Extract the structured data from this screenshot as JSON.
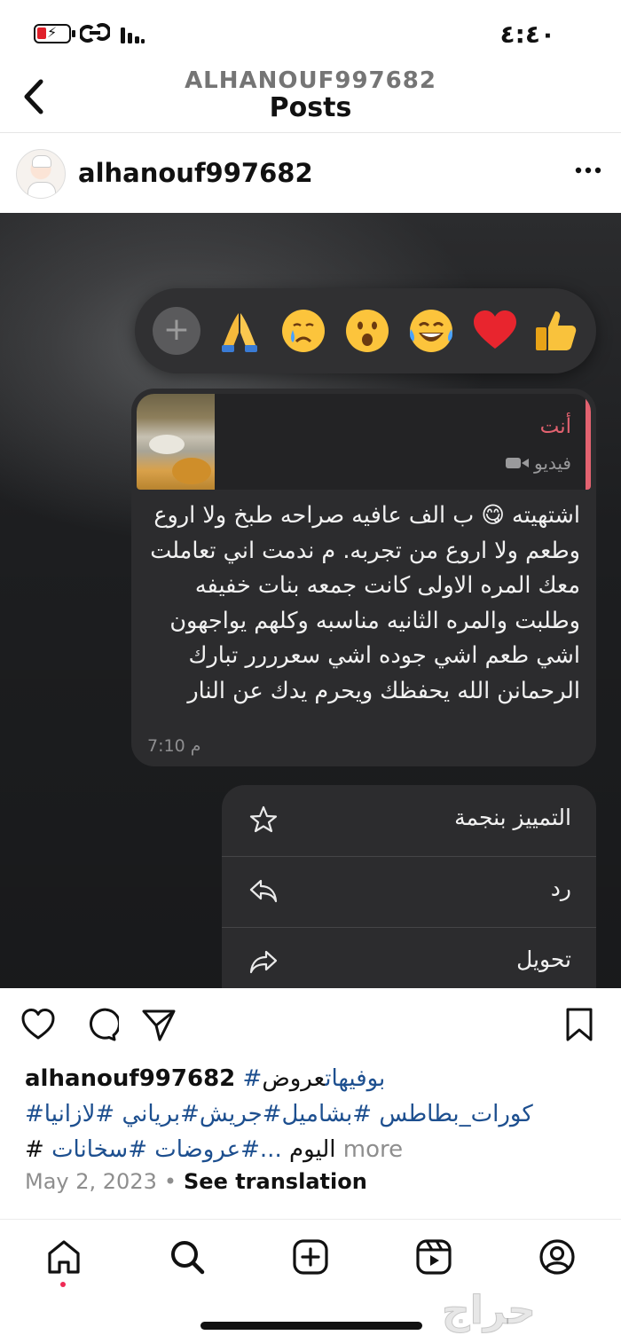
{
  "status_bar": {
    "time": "٤:٤٠",
    "icons": [
      "battery-charging-icon",
      "link-icon",
      "signal-icon"
    ],
    "battery_level": 0.2
  },
  "header": {
    "username": "ALHANOUF997682",
    "title": "Posts",
    "back_icon": "chevron-left-icon"
  },
  "post": {
    "author": "alhanouf997682",
    "more_icon": "more-horizontal-icon"
  },
  "screenshot": {
    "reactions": [
      "👍",
      "❤️",
      "😂",
      "😮",
      "😢",
      "🙏"
    ],
    "reaction_add_label": "+",
    "reply": {
      "sender": "أنت",
      "type_label": "فيديو"
    },
    "message": {
      "text": "اشتهيته 😋 ب الف عافيه صراحه طبخ ولا اروع وطعم ولا اروع من تجربه. م ندمت اني تعاملت معك المره الاولى كانت جمعه بنات خفيفه وطلبت والمره الثانيه مناسبه وكلهم يواجهون اشي طعم اشي جوده اشي سعرررر تبارك الرحمانن الله يحفظك ويحرم يدك عن النار",
      "time": "7:10 م"
    },
    "menu": {
      "star_label": "التمييز بنجمة",
      "reply_label": "رد",
      "forward_label": "تحويل"
    }
  },
  "actions": {
    "icons": [
      "heart-icon",
      "comment-icon",
      "share-icon",
      "bookmark-icon"
    ]
  },
  "caption": {
    "username": "alhanouf997682",
    "line1_tags": "#بوفيهات",
    "line1_text": "عروض",
    "line2": "#كورات_بطاطس #بشاميل#جريش#برياني #لازانيا",
    "line3_more": "more",
    "line3_tags": "...#عروضات #سخانات",
    "line3_text": "# اليوم",
    "date": "May 2, 2023",
    "see_translation": "See translation"
  },
  "bottom_nav": {
    "items": [
      "home-icon",
      "search-icon",
      "create-icon",
      "reels-icon",
      "profile-icon"
    ],
    "active": "home-icon"
  },
  "watermark": "حراج",
  "colors": {
    "hashtag": "#1d4f8f",
    "reply_accent": "#e36270",
    "bubble": "#2c2c2e",
    "notification_dot": "#ef2a55"
  }
}
